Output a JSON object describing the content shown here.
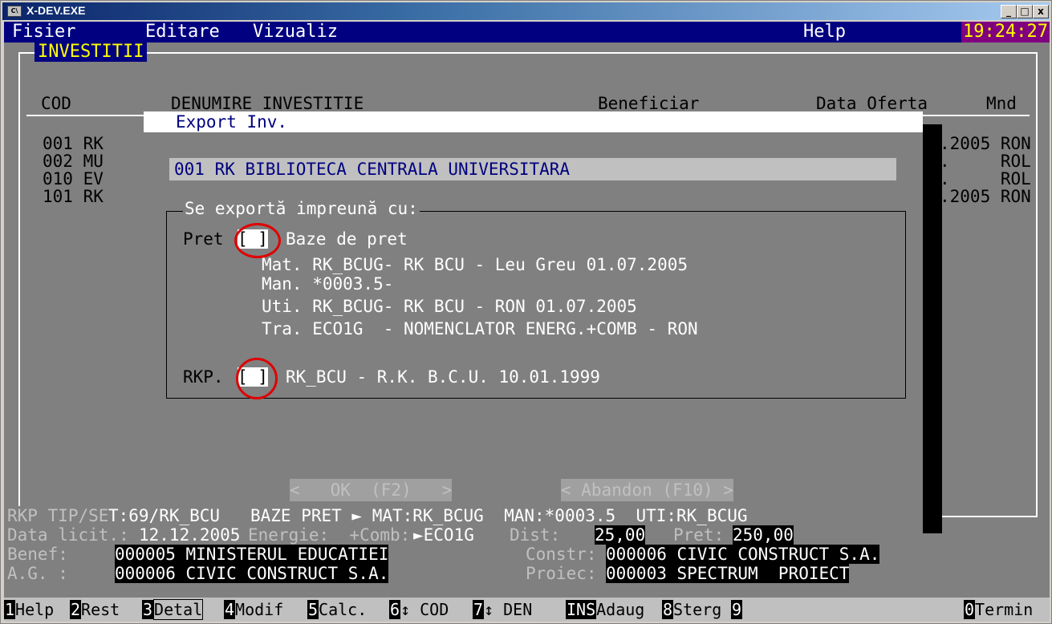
{
  "window": {
    "icon_text": "C\\",
    "title": "X-DEV.EXE",
    "btn_min": "_",
    "btn_max": "□",
    "btn_close": "x"
  },
  "menu": {
    "items": [
      {
        "hotkey": "F",
        "rest": "isier"
      },
      {
        "hotkey": "E",
        "rest": "ditare"
      },
      {
        "hotkey": "V",
        "rest": "izualiz"
      },
      {
        "hotkey": "H",
        "rest": "elp"
      }
    ],
    "clock": "19:24:27"
  },
  "panel": {
    "title": "INVESTITII",
    "columns": [
      "COD",
      "DENUMIRE INVESTITIE",
      "Beneficiar",
      "Data Oferta",
      "Mnd"
    ],
    "rows": [
      {
        "cod": "001",
        "den": "RK",
        "date": ".2005",
        "mnd": "RON"
      },
      {
        "cod": "002",
        "den": "MU",
        "date": ".",
        "mnd": "ROL"
      },
      {
        "cod": "010",
        "den": "EV",
        "date": ".",
        "mnd": "ROL"
      },
      {
        "cod": "101",
        "den": "RK",
        "date": ".2005",
        "mnd": "RON"
      }
    ]
  },
  "dialog": {
    "title": "Export Inv.",
    "investment": "001 RK BIBLIOTECA CENTRALA UNIVERSITARA",
    "group_title": "Se exportă impreună cu:",
    "pret_label": "Pret",
    "pret_checkbox": "[ ]",
    "pret_text": "Baze de pret",
    "mat": "Mat. RK_BCUG- RK BCU - Leu Greu 01.07.2005",
    "man": "Man. *0003.5-",
    "uti": "Uti. RK_BCUG- RK BCU - RON 01.07.2005",
    "tra": "Tra. ECO1G  - NOMENCLATOR ENERG.+COMB - RON",
    "rkp_label": "RKP.",
    "rkp_checkbox": "[ ]",
    "rkp_text": "RK_BCU - R.K. B.C.U. 10.01.1999",
    "ok_button": "<   OK  (F2)   >",
    "cancel_button": "< Abandon (F10) >"
  },
  "status": {
    "line1_label": "RKP TIP/SE",
    "line1_value": "T:69/RK_BCU   BAZE PRET ► MAT:RK_BCUG  MAN:*0003.5  UTI:RK_BCUG",
    "data_licit_label": "Data licit.:",
    "data_licit_value": "12.12.2005",
    "energie_label": "Energie:  +Comb:",
    "energie_value": "►ECO1G",
    "dist_label": "Dist:",
    "dist_value": "25,00",
    "pret_label": "Pret:",
    "pret_value": "250,00",
    "benef_label": "Benef:",
    "benef_value": "000005 MINISTERUL EDUCATIEI",
    "constr_label": "Constr:",
    "constr_value": "000006 CIVIC CONSTRUCT S.A.",
    "ag_label": "A.G. :",
    "ag_value": "000006 CIVIC CONSTRUCT S.A.",
    "proiec_label": "Proiec:",
    "proiec_value": "000003 SPECTRUM  PROIECT"
  },
  "fkeys": [
    {
      "n": "1",
      "t": "Help"
    },
    {
      "n": "2",
      "t": "Rest"
    },
    {
      "n": "3",
      "t": "Detal"
    },
    {
      "n": "4",
      "t": "Modif"
    },
    {
      "n": "5",
      "t": "Calc."
    },
    {
      "n": "6",
      "t": "↕ COD"
    },
    {
      "n": "7",
      "t": "↕ DEN"
    },
    {
      "n": "INS",
      "t": "Adaug"
    },
    {
      "n": "8",
      "t": "Sterg"
    },
    {
      "n": "9",
      "t": ""
    },
    {
      "n": "0",
      "t": "Termin"
    }
  ],
  "colors": {
    "menu_bg": "#000080",
    "clock_bg": "#800080",
    "clock_fg": "#ffff00",
    "circle": "#e00000"
  }
}
